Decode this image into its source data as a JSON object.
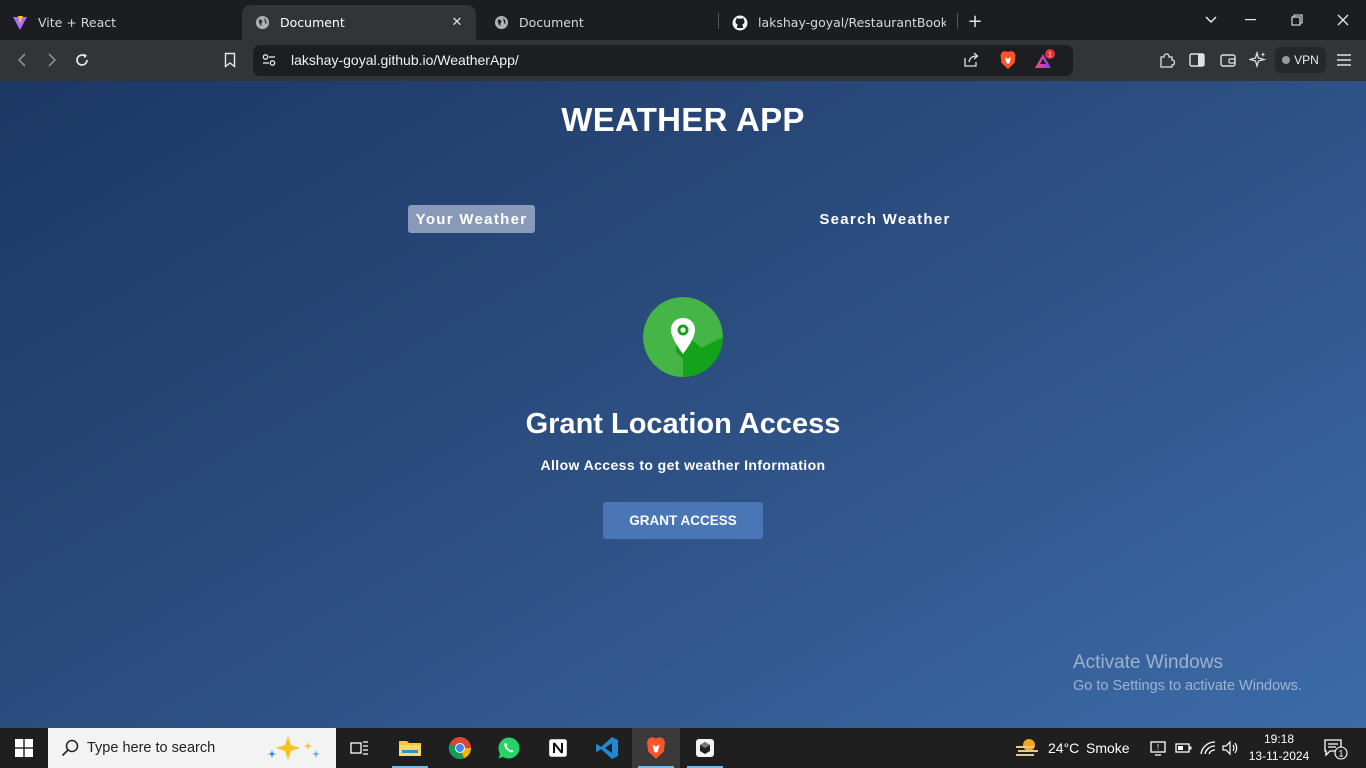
{
  "browser": {
    "tabs": [
      {
        "title": "Vite + React",
        "icon": "vite-icon",
        "active": false
      },
      {
        "title": "Document",
        "icon": "globe-icon",
        "active": true
      },
      {
        "title": "Document",
        "icon": "globe-icon",
        "active": false
      },
      {
        "title": "lakshay-goyal/RestaurantBookingSy",
        "icon": "github-icon",
        "active": false
      }
    ],
    "url": "lakshay-goyal.github.io/WeatherApp/",
    "notification_badge": "1",
    "vpn_label": "VPN"
  },
  "page": {
    "title": "WEATHER APP",
    "tabs": [
      {
        "label": "Your Weather",
        "selected": true
      },
      {
        "label": "Search Weather",
        "selected": false
      }
    ],
    "grant_title": "Grant Location Access",
    "grant_subtitle": "Allow Access to get weather Information",
    "grant_button": "GRANT ACCESS"
  },
  "watermark": {
    "line1": "Activate Windows",
    "line2": "Go to Settings to activate Windows."
  },
  "taskbar": {
    "search_placeholder": "Type here to search",
    "weather_temp": "24°C",
    "weather_desc": "Smoke",
    "time": "19:18",
    "date": "13-11-2024",
    "notification_count": "1"
  },
  "colors": {
    "page_gradient_start": "#1c3764",
    "page_gradient_end": "#3c6ba8",
    "button": "#4a76b5",
    "location_icon_green": "#3ab53a"
  }
}
